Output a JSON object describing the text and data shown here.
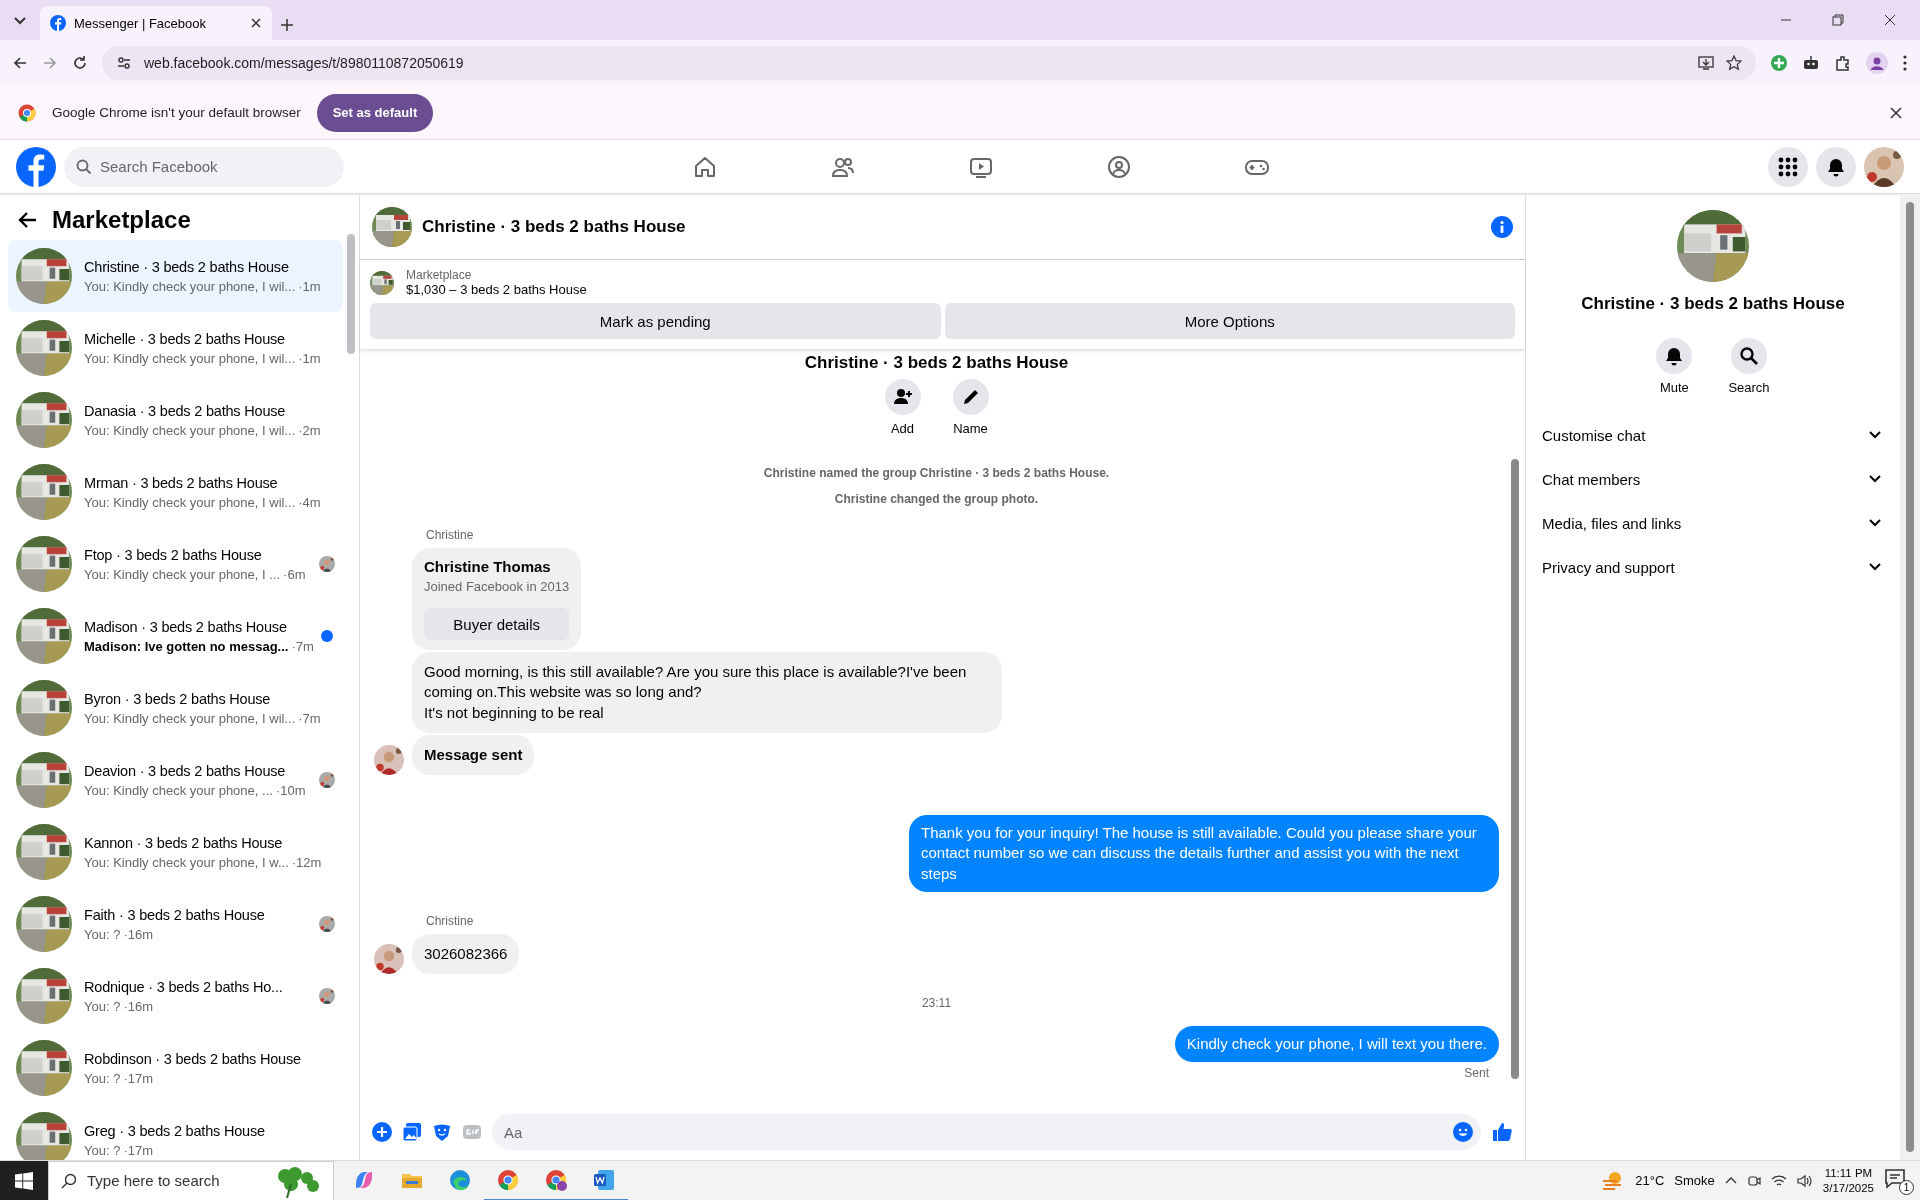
{
  "browser": {
    "tab": {
      "title": "Messenger | Facebook"
    },
    "url": "web.facebook.com/messages/t/8980110872050619",
    "infobar": {
      "text": "Google Chrome isn't your default browser",
      "button": "Set as default"
    }
  },
  "facebook": {
    "search": {
      "placeholder": "Search Facebook"
    },
    "nav": [
      {
        "kind": "home",
        "selected": false
      },
      {
        "kind": "friends",
        "selected": false
      },
      {
        "kind": "video",
        "selected": false
      },
      {
        "kind": "groups",
        "selected": false
      },
      {
        "kind": "gaming",
        "selected": false
      }
    ]
  },
  "sidebar": {
    "title": "Marketplace",
    "conversations": [
      {
        "name": "Christine · 3 beds 2 baths House",
        "preview": "You: Kindly check your phone, I wil...",
        "time": "·1m",
        "selected": true,
        "unread": false,
        "read_receipt": false
      },
      {
        "name": "Michelle · 3 beds 2 baths House",
        "preview": "You: Kindly check your phone, I wil...",
        "time": "·1m",
        "selected": false,
        "unread": false,
        "read_receipt": false
      },
      {
        "name": "Danasia · 3 beds 2 baths House",
        "preview": "You: Kindly check your phone, I wil...",
        "time": "·2m",
        "selected": false,
        "unread": false,
        "read_receipt": false
      },
      {
        "name": "Mrman · 3 beds 2 baths House",
        "preview": "You: Kindly check your phone, I wil...",
        "time": "·4m",
        "selected": false,
        "unread": false,
        "read_receipt": false
      },
      {
        "name": "Ftop · 3 beds 2 baths House",
        "preview": "You: Kindly check your phone, I ...",
        "time": "·6m",
        "selected": false,
        "unread": false,
        "read_receipt": true
      },
      {
        "name": "Madison · 3 beds 2 baths House",
        "preview": "Madison: Ive gotten no messag...",
        "time": "·7m",
        "selected": false,
        "unread": true,
        "read_receipt": false
      },
      {
        "name": "Byron · 3 beds 2 baths House",
        "preview": "You: Kindly check your phone, I wil...",
        "time": "·7m",
        "selected": false,
        "unread": false,
        "read_receipt": false
      },
      {
        "name": "Deavion · 3 beds 2 baths House",
        "preview": "You: Kindly check your phone, ...",
        "time": "·10m",
        "selected": false,
        "unread": false,
        "read_receipt": true
      },
      {
        "name": "Kannon · 3 beds 2 baths House",
        "preview": "You: Kindly check your phone, I w...",
        "time": "·12m",
        "selected": false,
        "unread": false,
        "read_receipt": false
      },
      {
        "name": "Faith · 3 beds 2 baths House",
        "preview": "You: ?",
        "time": "·16m",
        "selected": false,
        "unread": false,
        "read_receipt": true
      },
      {
        "name": "Rodnique · 3 beds 2 baths Ho...",
        "preview": "You: ?",
        "time": "·16m",
        "selected": false,
        "unread": false,
        "read_receipt": true
      },
      {
        "name": "Robdinson · 3 beds 2 baths House",
        "preview": "You: ?",
        "time": "·17m",
        "selected": false,
        "unread": false,
        "read_receipt": false
      },
      {
        "name": "Greg · 3 beds 2 baths House",
        "preview": "You: ?",
        "time": "·17m",
        "selected": false,
        "unread": false,
        "read_receipt": false
      }
    ]
  },
  "chat": {
    "title": "Christine · 3 beds 2 baths House",
    "listing": {
      "label": "Marketplace",
      "title": "$1,030 – 3 beds 2 baths House",
      "buttons": [
        "Mark as pending",
        "More Options"
      ]
    },
    "intro": {
      "title": "Christine · 3 beds 2 baths House",
      "actions": [
        {
          "kind": "add",
          "label": "Add"
        },
        {
          "kind": "name",
          "label": "Name"
        }
      ]
    },
    "messages": [
      {
        "kind": "system",
        "text": "Christine named the group Christine · 3 beds 2 baths House."
      },
      {
        "kind": "system",
        "text": "Christine changed the group photo."
      },
      {
        "kind": "sender",
        "text": "Christine"
      },
      {
        "kind": "buyer_card",
        "name": "Christine Thomas",
        "subtitle": "Joined Facebook in 2013",
        "button": "Buyer details"
      },
      {
        "kind": "incoming",
        "text": "Good morning, is this still available? Are you sure this place is available?I've been coming on.This website was so long and?\nIt's not beginning to be real",
        "avatar": false
      },
      {
        "kind": "incoming",
        "text": "Message sent",
        "avatar": true,
        "bold": true
      },
      {
        "kind": "outgoing",
        "text": "Thank you for your inquiry! The house is still available. Could you please share your contact number so we can discuss the details further and assist you with the next steps"
      },
      {
        "kind": "sender",
        "text": "Christine"
      },
      {
        "kind": "incoming",
        "text": "3026082366",
        "avatar": true,
        "bold": false
      },
      {
        "kind": "time",
        "text": "23:11"
      },
      {
        "kind": "outgoing",
        "text": "Kindly check your phone, I will text you there."
      },
      {
        "kind": "status",
        "text": "Sent"
      }
    ],
    "composer": {
      "placeholder": "Aa"
    }
  },
  "details": {
    "title": "Christine · 3 beds 2 baths House",
    "actions": [
      {
        "kind": "mute",
        "label": "Mute"
      },
      {
        "kind": "search",
        "label": "Search"
      }
    ],
    "sections": [
      {
        "label": "Customise chat",
        "expanded": false
      },
      {
        "label": "Chat members",
        "expanded": false
      },
      {
        "label": "Media, files and links",
        "expanded": false
      },
      {
        "label": "Privacy and support",
        "expanded": false
      }
    ]
  },
  "taskbar": {
    "search": {
      "placeholder": "Type here to search"
    },
    "weather": {
      "temp": "21°C",
      "condition": "Smoke"
    },
    "time": "11:11 PM",
    "date": "3/17/2025",
    "notifications": "1"
  }
}
